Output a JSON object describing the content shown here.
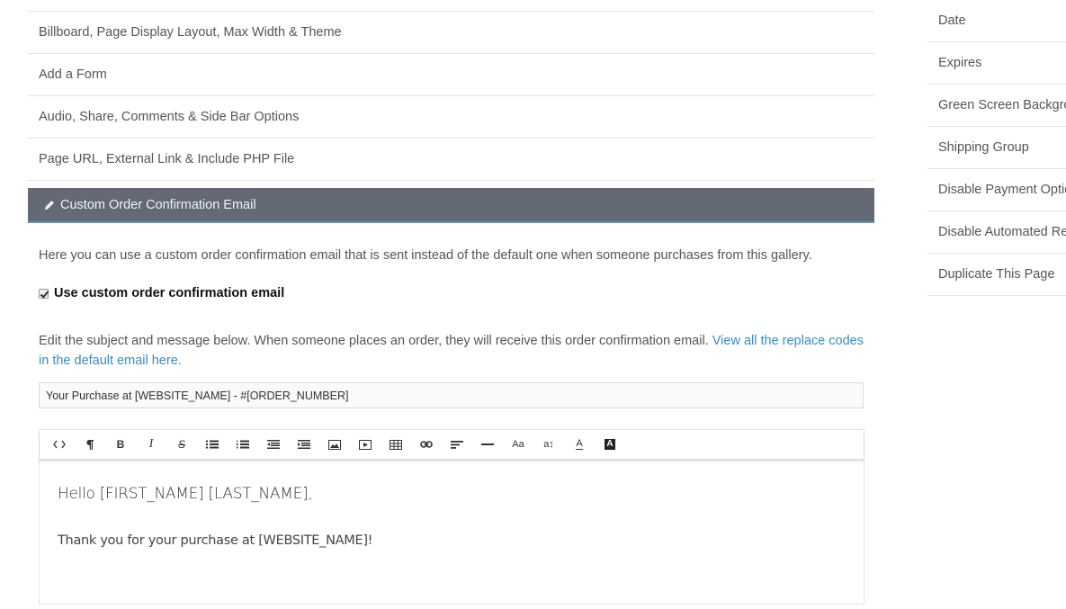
{
  "sections": [
    {
      "label": "Billboard, Page Display Layout, Max Width & Theme"
    },
    {
      "label": "Add a Form"
    },
    {
      "label": "Audio, Share, Comments & Side Bar Options"
    },
    {
      "label": "Page URL, External Link & Include PHP File"
    }
  ],
  "active_section": {
    "icon": "pencil-icon",
    "label": "Custom Order Confirmation Email"
  },
  "content": {
    "intro": "Here you can use a custom order confirmation email that is sent instead of the default one when someone purchases from this gallery.",
    "checkbox": {
      "label": "Use custom order confirmation email",
      "checked": true
    },
    "description": "Edit the subject and message below. When someone places an order, they will receive this order confirmation email. ",
    "description_link": "View all the replace codes in the default email here.",
    "subject_value": "Your Purchase at [WEBSITE_NAME] - #[ORDER_NUMBER]"
  },
  "toolbar": {
    "buttons": [
      {
        "name": "code-view",
        "icon": "code-icon",
        "glyph": "<>"
      },
      {
        "name": "paragraph",
        "icon": "paragraph-icon",
        "glyph": "¶"
      },
      {
        "name": "bold",
        "icon": "bold-icon",
        "glyph": "B"
      },
      {
        "name": "italic",
        "icon": "italic-icon",
        "glyph": "I"
      },
      {
        "name": "strikethrough",
        "icon": "strikethrough-icon",
        "glyph": "S"
      },
      {
        "name": "unordered-list",
        "icon": "bullet-list-icon",
        "glyph": ""
      },
      {
        "name": "ordered-list",
        "icon": "numbered-list-icon",
        "glyph": ""
      },
      {
        "name": "outdent",
        "icon": "outdent-icon",
        "glyph": ""
      },
      {
        "name": "indent",
        "icon": "indent-icon",
        "glyph": ""
      },
      {
        "name": "image",
        "icon": "image-icon",
        "glyph": ""
      },
      {
        "name": "video",
        "icon": "video-icon",
        "glyph": ""
      },
      {
        "name": "table",
        "icon": "table-icon",
        "glyph": ""
      },
      {
        "name": "link",
        "icon": "link-icon",
        "glyph": ""
      },
      {
        "name": "align",
        "icon": "align-left-icon",
        "glyph": ""
      },
      {
        "name": "horizontal-rule",
        "icon": "horizontal-rule-icon",
        "glyph": ""
      },
      {
        "name": "font-family",
        "icon": "font-family-icon",
        "glyph": "Aa"
      },
      {
        "name": "font-size",
        "icon": "font-size-icon",
        "glyph": "a↕"
      },
      {
        "name": "text-color",
        "icon": "text-color-icon",
        "glyph": "A"
      },
      {
        "name": "background-color",
        "icon": "background-color-icon",
        "glyph": "A"
      }
    ]
  },
  "editor": {
    "greeting": "Hello [FIRST_NAME] [LAST_NAME],",
    "thanks": "Thank you for your purchase at  [WEBSITE_NAME]!"
  },
  "sidebar": {
    "items": [
      {
        "label": "Date"
      },
      {
        "label": "Expires"
      },
      {
        "label": "Green Screen Background"
      },
      {
        "label": "Shipping Group"
      },
      {
        "label": "Disable Payment Options"
      },
      {
        "label": "Disable Automated Reminders"
      },
      {
        "label": "Duplicate This Page"
      }
    ]
  },
  "colors": {
    "active_header_bg": "#636a75",
    "active_header_border": "#6c8fb4",
    "link": "#3a8cc4"
  }
}
